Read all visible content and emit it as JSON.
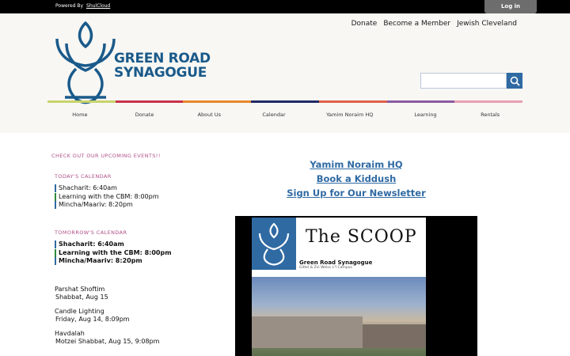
{
  "topbar": {
    "powered_by": "Powered By",
    "powered_link": "ShulCloud",
    "login": "Log in"
  },
  "header": {
    "links": [
      "Donate",
      "Become a Member",
      "Jewish Cleveland"
    ],
    "logo_line1": "GREEN ROAD",
    "logo_line2": "SYNAGOGUE",
    "search_placeholder": ""
  },
  "colors": [
    "#c8d46a",
    "#c8324a",
    "#e8882a",
    "#1f2a64",
    "#e0604a",
    "#8a5aa0",
    "#e8a0b0"
  ],
  "nav": [
    "Home",
    "Donate",
    "About Us",
    "Calendar",
    "Yamim Noraim HQ",
    "Learning",
    "Rentals"
  ],
  "sidebar": {
    "heading": "CHECK OUT OUR UPCOMING EVENTS!!",
    "today_label": "TODAY'S CALENDAR",
    "today": [
      "Shacharit: 6:40am",
      "Learning with the CBM: 8:00pm",
      "Mincha/Maariv: 8:20pm"
    ],
    "tomorrow_label": "TOMORROW'S CALENDAR",
    "tomorrow": [
      "Shacharit: 6:40am",
      "Learning with the CBM: 8:00pm",
      "Mincha/Maariv: 8:20pm"
    ],
    "parsha_title": "Parshat Shoftim",
    "parsha_date": "Shabbat, Aug 15",
    "candle_title": "Candle Lighting",
    "candle_date": "Friday, Aug 14, 8:09pm",
    "havdalah_title": "Havdalah",
    "havdalah_date": "Motzei Shabbat, Aug 15, 9:08pm"
  },
  "center_links": [
    "Yamim Noraim HQ",
    "Book a Kiddush",
    "Sign Up for Our Newsletter"
  ],
  "newsletter": {
    "title": "The SCOOP",
    "subtitle": "Green Road Synagogue",
    "campus": "Gittel & Zvi Weiss z\"l Campus"
  }
}
